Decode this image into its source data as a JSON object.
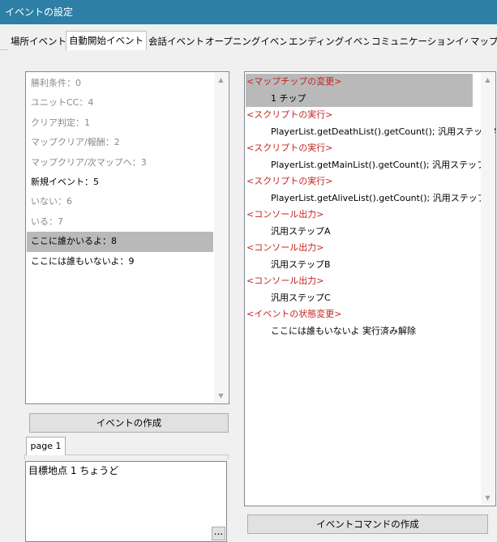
{
  "window": {
    "title": "イベントの設定"
  },
  "tabs": [
    {
      "label": "場所イベント"
    },
    {
      "label": "自動開始イベント"
    },
    {
      "label": "会話イベント"
    },
    {
      "label": "オープニングイベント"
    },
    {
      "label": "エンディングイベント"
    },
    {
      "label": "コミュニケーションイベント"
    },
    {
      "label": "マップチ"
    }
  ],
  "events": [
    {
      "label": "勝利条件：0"
    },
    {
      "label": "ユニットCC：4"
    },
    {
      "label": "クリア判定：1"
    },
    {
      "label": "マップクリア/報酬：2"
    },
    {
      "label": "マップクリア/次マップへ：3"
    },
    {
      "label": "新規イベント：5"
    },
    {
      "label": "いない：6"
    },
    {
      "label": "いる：7"
    },
    {
      "label": "ここに誰かいるよ：8"
    },
    {
      "label": "ここには誰もいないよ：9"
    }
  ],
  "buttons": {
    "create_event": "イベントの作成",
    "create_command": "イベントコマンドの作成",
    "ellipsis": "..."
  },
  "page_tab": {
    "label": "page 1"
  },
  "condition": {
    "text": "目標地点 1 ちょうど"
  },
  "commands": [
    {
      "head": "<マップチップの変更>",
      "detail": "1 チップ"
    },
    {
      "head": "<スクリプトの実行>",
      "detail": "PlayerList.getDeathList().getCount(); 汎用ステップA"
    },
    {
      "head": "<スクリプトの実行>",
      "detail": "PlayerList.getMainList().getCount(); 汎用ステップB"
    },
    {
      "head": "<スクリプトの実行>",
      "detail": "PlayerList.getAliveList().getCount(); 汎用ステップC"
    },
    {
      "head": "<コンソール出力>",
      "detail": "汎用ステップA"
    },
    {
      "head": "<コンソール出力>",
      "detail": "汎用ステップB"
    },
    {
      "head": "<コンソール出力>",
      "detail": "汎用ステップC"
    },
    {
      "head": "<イベントの状態変更>",
      "detail": "ここには誰もいないよ 実行済み解除"
    }
  ],
  "icons": {
    "scroll_up": "chevron-up-icon",
    "scroll_down": "chevron-down-icon"
  },
  "colors": {
    "titlebar": "#2d7fa5",
    "command_head": "#c4241e",
    "selection": "#b9b9b9"
  }
}
